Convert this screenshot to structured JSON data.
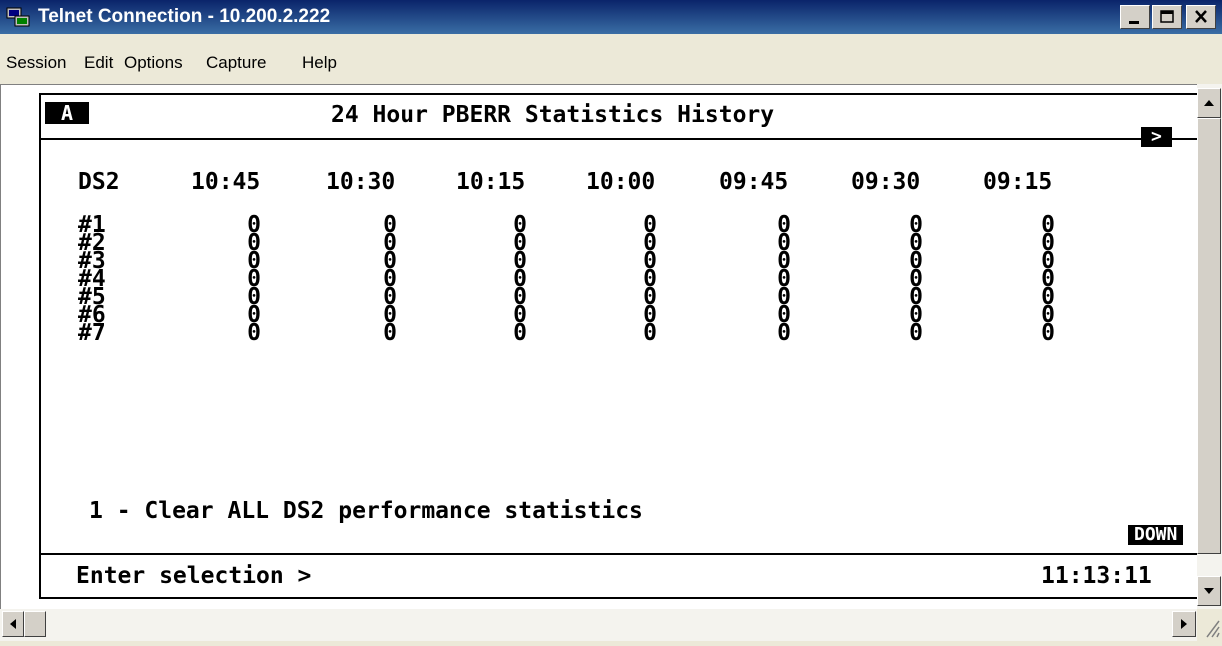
{
  "window": {
    "title": "Telnet Connection - 10.200.2.222"
  },
  "menu": [
    "Session",
    "Edit",
    "Options",
    "Capture",
    "Help"
  ],
  "terminal": {
    "tag": "A",
    "title": "24 Hour PBERR Statistics History",
    "nav_arrow": ">",
    "header": [
      "DS2",
      "10:45",
      "10:30",
      "10:15",
      "10:00",
      "09:45",
      "09:30",
      "09:15"
    ],
    "rows": [
      {
        "label": "#1",
        "values": [
          "0",
          "0",
          "0",
          "0",
          "0",
          "0",
          "0"
        ]
      },
      {
        "label": "#2",
        "values": [
          "0",
          "0",
          "0",
          "0",
          "0",
          "0",
          "0"
        ]
      },
      {
        "label": "#3",
        "values": [
          "0",
          "0",
          "0",
          "0",
          "0",
          "0",
          "0"
        ]
      },
      {
        "label": "#4",
        "values": [
          "0",
          "0",
          "0",
          "0",
          "0",
          "0",
          "0"
        ]
      },
      {
        "label": "#5",
        "values": [
          "0",
          "0",
          "0",
          "0",
          "0",
          "0",
          "0"
        ]
      },
      {
        "label": "#6",
        "values": [
          "0",
          "0",
          "0",
          "0",
          "0",
          "0",
          "0"
        ]
      },
      {
        "label": "#7",
        "values": [
          "0",
          "0",
          "0",
          "0",
          "0",
          "0",
          "0"
        ]
      }
    ],
    "option_1": "1 - Clear ALL DS2 performance statistics",
    "down_label": "DOWN",
    "prompt": "Enter selection >",
    "clock": "11:13:11"
  },
  "icons": {
    "app": "telnet-app-icon",
    "minimize": "minimize-icon",
    "maximize": "maximize-icon",
    "close": "close-icon",
    "scroll_up": "arrow-up-icon",
    "scroll_down": "arrow-down-icon",
    "scroll_left": "arrow-left-icon",
    "scroll_right": "arrow-right-icon"
  }
}
